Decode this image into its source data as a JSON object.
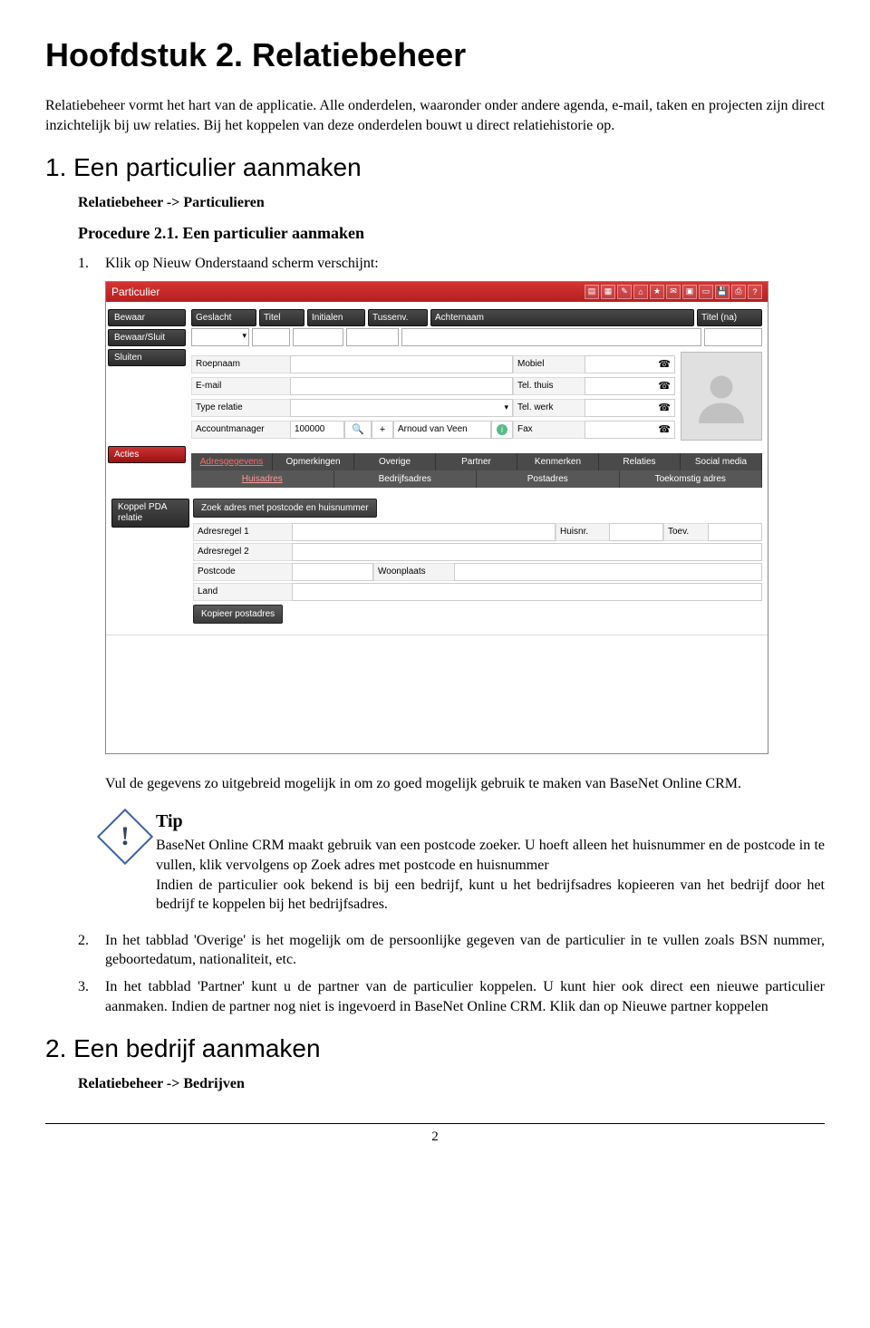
{
  "chapter_title": "Hoofdstuk 2. Relatiebeheer",
  "intro": "Relatiebeheer vormt het hart van de applicatie. Alle onderdelen, waaronder onder andere agenda, e-mail, taken en projecten zijn direct inzichtelijk bij uw relaties. Bij het koppelen van deze onderdelen bouwt u direct relatiehistorie op.",
  "section1": {
    "title": "1. Een particulier aanmaken",
    "breadcrumb": "Relatiebeheer -> Particulieren",
    "procedure_title": "Procedure 2.1. Een particulier aanmaken",
    "step1_num": "1.",
    "step1_text": "Klik op Nieuw Onderstaand scherm verschijnt:",
    "after_ss": "Vul de gegevens zo uitgebreid mogelijk in om zo goed mogelijk gebruik te maken van BaseNet Online CRM.",
    "tip_title": "Tip",
    "tip_body_a": "BaseNet Online CRM maakt gebruik van een postcode zoeker. U hoeft alleen het huisnummer en de postcode in te vullen, klik vervolgens op Zoek adres met postcode en huisnummer",
    "tip_body_b": "Indien de particulier ook bekend is bij een bedrijf, kunt u het bedrijfsadres kopieeren van het bedrijf door het bedrijf te koppelen bij het bedrijfsadres.",
    "step2_num": "2.",
    "step2_text": "In het tabblad 'Overige' is het mogelijk om de persoonlijke gegeven van de particulier in te vullen zoals BSN nummer, geboortedatum, nationaliteit, etc.",
    "step3_num": "3.",
    "step3_text": "In het tabblad 'Partner' kunt u de partner van de particulier koppelen. U kunt hier ook direct een nieuwe particulier aanmaken. Indien de partner nog niet is ingevoerd in BaseNet Online CRM. Klik dan op Nieuwe partner koppelen"
  },
  "section2": {
    "title": "2. Een bedrijf aanmaken",
    "breadcrumb": "Relatiebeheer -> Bedrijven"
  },
  "page_number": "2",
  "screenshot": {
    "title": "Particulier",
    "left_buttons": [
      "Bewaar",
      "Bewaar/Sluit",
      "Sluiten"
    ],
    "left_buttons2": [
      "Acties"
    ],
    "left_buttons3": [
      "Koppel PDA relatie"
    ],
    "topfields": [
      "Geslacht",
      "Titel",
      "Initialen",
      "Tussenv.",
      "Achternaam",
      "Titel (na)"
    ],
    "rows_left": [
      "Roepnaam",
      "E-mail",
      "Type relatie",
      "Accountmanager"
    ],
    "rows_right": [
      "Mobiel",
      "Tel. thuis",
      "Tel. werk",
      "Fax"
    ],
    "account_id": "100000",
    "account_name": "Arnoud van Veen",
    "tabs": [
      "Adresgegevens",
      "Opmerkingen",
      "Overige",
      "Partner",
      "Kenmerken",
      "Relaties",
      "Social media"
    ],
    "subtabs": [
      "Huisadres",
      "Bedrijfsadres",
      "Postadres",
      "Toekomstig adres"
    ],
    "zoek_button": "Zoek adres met postcode en huisnummer",
    "addr_labels": {
      "r1": "Adresregel 1",
      "huisnr": "Huisnr.",
      "toev": "Toev.",
      "r2": "Adresregel 2",
      "pc": "Postcode",
      "wp": "Woonplaats",
      "land": "Land"
    },
    "copy_button": "Kopieer postadres"
  }
}
